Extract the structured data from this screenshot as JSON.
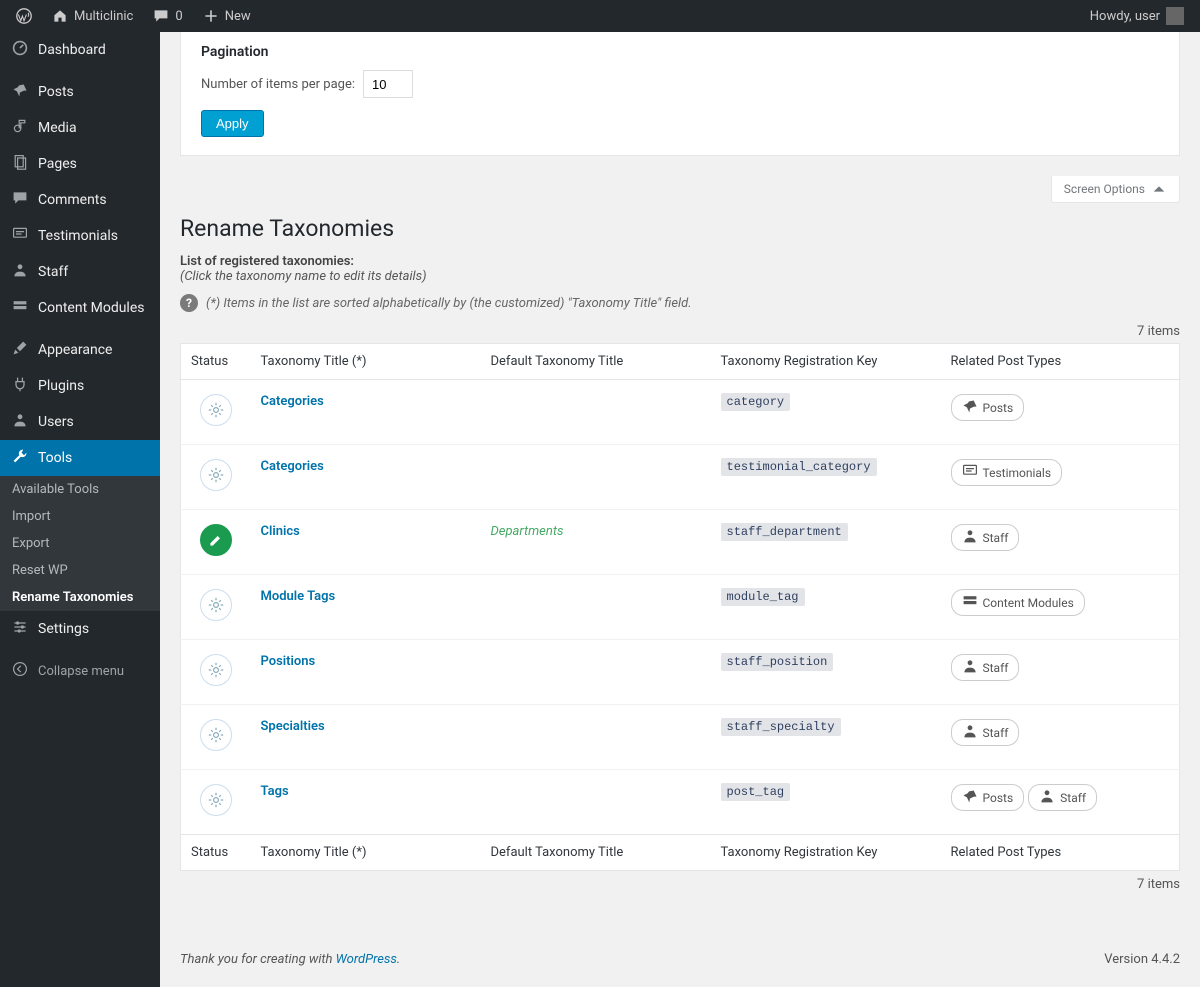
{
  "adminbar": {
    "site_name": "Multiclinic",
    "comment_count": "0",
    "new_label": "New",
    "howdy": "Howdy, user"
  },
  "sidebar": {
    "items": [
      {
        "label": "Dashboard",
        "icon": "dashboard"
      },
      {
        "label": "Posts",
        "icon": "pin"
      },
      {
        "label": "Media",
        "icon": "media"
      },
      {
        "label": "Pages",
        "icon": "pages"
      },
      {
        "label": "Comments",
        "icon": "comment"
      },
      {
        "label": "Testimonials",
        "icon": "testimonial"
      },
      {
        "label": "Staff",
        "icon": "person"
      },
      {
        "label": "Content Modules",
        "icon": "modules"
      },
      {
        "label": "Appearance",
        "icon": "brush"
      },
      {
        "label": "Plugins",
        "icon": "plug"
      },
      {
        "label": "Users",
        "icon": "person"
      },
      {
        "label": "Tools",
        "icon": "wrench",
        "current": true
      },
      {
        "label": "Settings",
        "icon": "sliders"
      }
    ],
    "submenu": [
      {
        "label": "Available Tools"
      },
      {
        "label": "Import"
      },
      {
        "label": "Export"
      },
      {
        "label": "Reset WP"
      },
      {
        "label": "Rename Taxonomies",
        "current": true
      }
    ],
    "collapse": "Collapse menu"
  },
  "screen_options": "Screen Options",
  "pagination": {
    "heading": "Pagination",
    "label": "Number of items per page:",
    "value": "10",
    "apply": "Apply"
  },
  "page": {
    "title": "Rename Taxonomies",
    "list_label": "List of registered taxonomies:",
    "list_hint": "(Click the taxonomy name to edit its details)",
    "sort_note": "(*) Items in the list are sorted alphabetically by (the customized) \"Taxonomy Title\" field.",
    "items_count": "7 items"
  },
  "table": {
    "headers": {
      "status": "Status",
      "title": "Taxonomy Title (*)",
      "default": "Default Taxonomy Title",
      "key": "Taxonomy Registration Key",
      "related": "Related Post Types"
    },
    "rows": [
      {
        "edited": false,
        "title": "Categories",
        "default": "",
        "key": "category",
        "related": [
          {
            "icon": "pin",
            "label": "Posts"
          }
        ]
      },
      {
        "edited": false,
        "title": "Categories",
        "default": "",
        "key": "testimonial_category",
        "related": [
          {
            "icon": "testimonial",
            "label": "Testimonials"
          }
        ]
      },
      {
        "edited": true,
        "title": "Clinics",
        "default": "Departments",
        "key": "staff_department",
        "related": [
          {
            "icon": "person",
            "label": "Staff"
          }
        ]
      },
      {
        "edited": false,
        "title": "Module Tags",
        "default": "",
        "key": "module_tag",
        "related": [
          {
            "icon": "modules",
            "label": "Content Modules"
          }
        ]
      },
      {
        "edited": false,
        "title": "Positions",
        "default": "",
        "key": "staff_position",
        "related": [
          {
            "icon": "person",
            "label": "Staff"
          }
        ]
      },
      {
        "edited": false,
        "title": "Specialties",
        "default": "",
        "key": "staff_specialty",
        "related": [
          {
            "icon": "person",
            "label": "Staff"
          }
        ]
      },
      {
        "edited": false,
        "title": "Tags",
        "default": "",
        "key": "post_tag",
        "related": [
          {
            "icon": "pin",
            "label": "Posts"
          },
          {
            "icon": "person",
            "label": "Staff"
          }
        ]
      }
    ]
  },
  "footer": {
    "thanks_pre": "Thank you for creating with ",
    "thanks_link": "WordPress",
    "thanks_post": ".",
    "version": "Version 4.4.2"
  }
}
